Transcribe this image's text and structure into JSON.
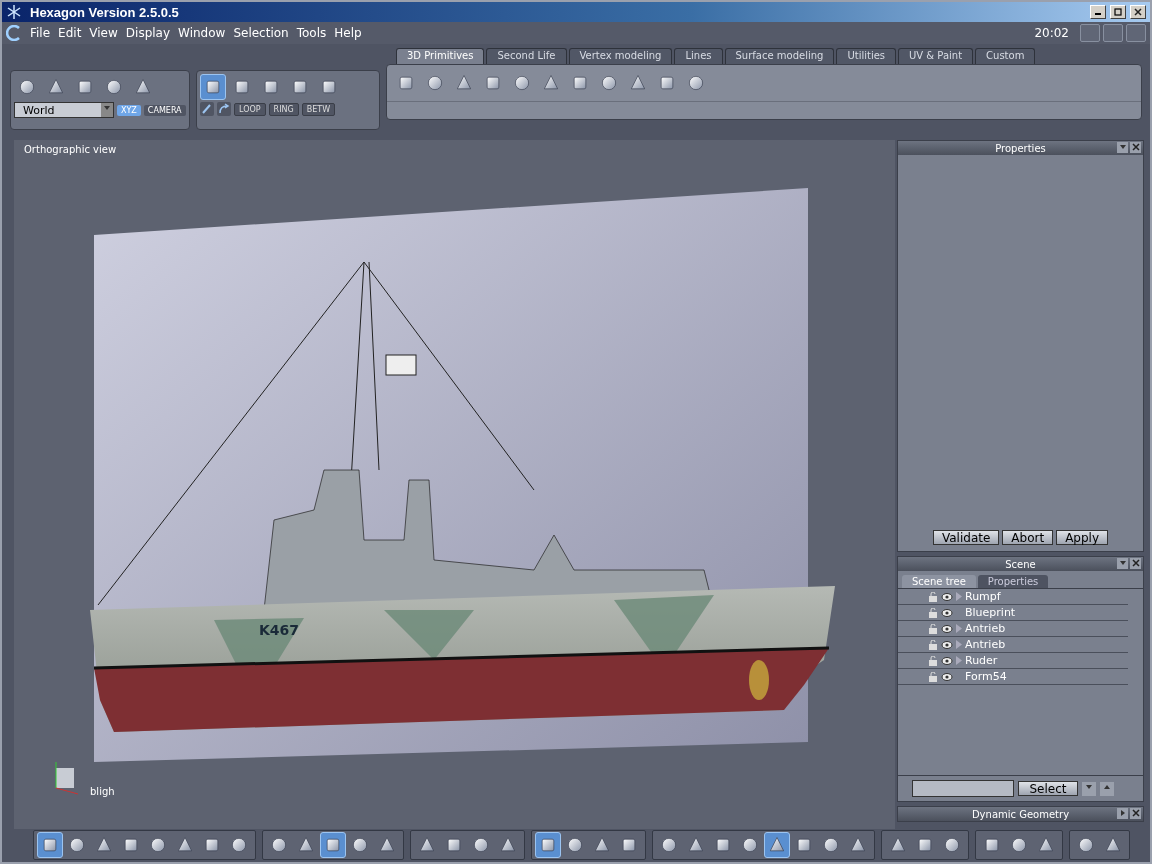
{
  "window": {
    "title": "Hexagon Version 2.5.0.5"
  },
  "menu": [
    "File",
    "Edit",
    "View",
    "Display",
    "Window",
    "Selection",
    "Tools",
    "Help"
  ],
  "clock": "20:02",
  "transform_tools": {
    "icons": [
      {
        "selected": false
      },
      {
        "selected": false
      },
      {
        "selected": false
      },
      {
        "selected": false
      },
      {
        "selected": false
      }
    ],
    "space": "World",
    "modes": [
      {
        "label": "XYZ",
        "selected": true
      },
      {
        "label": "CAMERA",
        "selected": false
      }
    ]
  },
  "selection_tools": {
    "icons": [
      {
        "selected": true
      },
      {
        "selected": false
      },
      {
        "selected": false
      },
      {
        "selected": false
      },
      {
        "selected": false
      }
    ],
    "buttons": [
      "LOOP",
      "RING",
      "BETW"
    ]
  },
  "tabs": [
    {
      "label": "3D Primitives",
      "selected": true
    },
    {
      "label": "Second Life",
      "selected": false
    },
    {
      "label": "Vertex modeling",
      "selected": false
    },
    {
      "label": "Lines",
      "selected": false
    },
    {
      "label": "Surface modeling",
      "selected": false
    },
    {
      "label": "Utilities",
      "selected": false
    },
    {
      "label": "UV & Paint",
      "selected": false
    },
    {
      "label": "Custom",
      "selected": false
    }
  ],
  "viewport": {
    "label": "Orthographic view",
    "hull_marking": "K467",
    "camera": "bligh"
  },
  "properties_panel": {
    "title": "Properties",
    "buttons": [
      "Validate",
      "Abort",
      "Apply"
    ]
  },
  "scene_panel": {
    "title": "Scene",
    "tabs": [
      {
        "label": "Scene tree",
        "selected": true
      },
      {
        "label": "Properties",
        "selected": false
      }
    ],
    "items": [
      {
        "name": "Rumpf",
        "expandable": true
      },
      {
        "name": "Blueprint",
        "expandable": false
      },
      {
        "name": "Antrieb",
        "expandable": true
      },
      {
        "name": "Antrieb",
        "expandable": true
      },
      {
        "name": "Ruder",
        "expandable": true
      },
      {
        "name": "Form54",
        "expandable": false
      }
    ],
    "select_button": "Select"
  },
  "dynamic_geometry_panel": {
    "title": "Dynamic Geometry"
  },
  "bottom_toolbar": [
    [
      {
        "selected": true
      },
      {
        "selected": false
      },
      {
        "selected": false
      },
      {
        "selected": false
      },
      {
        "selected": false
      },
      {
        "selected": false
      },
      {
        "selected": false
      },
      {
        "selected": false
      }
    ],
    [
      {
        "selected": false
      },
      {
        "selected": false
      },
      {
        "selected": true
      },
      {
        "selected": false
      },
      {
        "selected": false
      }
    ],
    [
      {
        "selected": false
      },
      {
        "selected": false
      },
      {
        "selected": false
      },
      {
        "selected": false
      }
    ],
    [
      {
        "selected": true
      },
      {
        "selected": false
      },
      {
        "selected": false
      },
      {
        "selected": false
      }
    ],
    [
      {
        "selected": false
      },
      {
        "selected": false
      },
      {
        "selected": false
      },
      {
        "selected": false
      },
      {
        "selected": true
      },
      {
        "selected": false
      },
      {
        "selected": false
      },
      {
        "selected": false
      }
    ],
    [
      {
        "selected": false
      },
      {
        "selected": false
      },
      {
        "selected": false
      }
    ],
    [
      {
        "selected": false
      },
      {
        "selected": false
      },
      {
        "selected": false
      }
    ],
    [
      {
        "selected": false
      },
      {
        "selected": false
      }
    ]
  ]
}
